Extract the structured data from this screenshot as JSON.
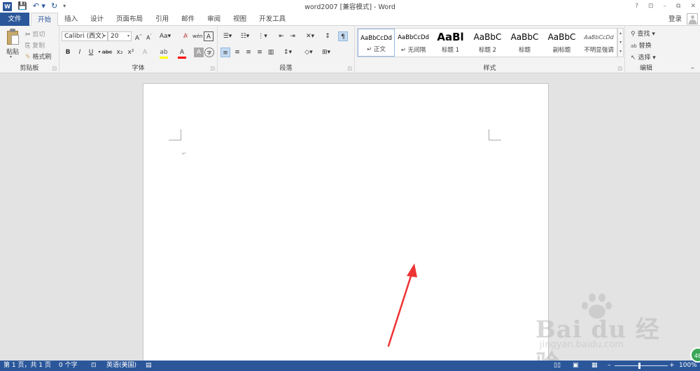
{
  "window": {
    "title": "word2007 [兼容模式] - Word",
    "controls": [
      "?",
      "⊡",
      "–",
      "⧉",
      "✕"
    ]
  },
  "qat": {
    "undo_icon": "undo-icon",
    "redo_icon": "redo-icon",
    "save_icon": "save-icon"
  },
  "tabs": {
    "file": "文件",
    "items": [
      "开始",
      "插入",
      "设计",
      "页面布局",
      "引用",
      "邮件",
      "审阅",
      "视图",
      "开发工具"
    ],
    "login": "登录"
  },
  "ribbon": {
    "clipboard": {
      "label": "剪贴板",
      "paste": "粘贴",
      "cut": "剪切",
      "copy": "复制",
      "format_painter": "格式刷"
    },
    "font": {
      "label": "字体",
      "font_name": "Calibri (西文)",
      "font_size": "20",
      "grow": "A˄",
      "shrink": "A˅",
      "case": "Aa",
      "bold": "B",
      "italic": "I",
      "underline": "U",
      "strike": "abc",
      "sub": "x₂",
      "sup": "x²",
      "phonetic": "wén"
    },
    "paragraph": {
      "label": "段落"
    },
    "styles": {
      "label": "样式",
      "items": [
        {
          "sample": "AaBbCcDd",
          "name": "↵ 正文"
        },
        {
          "sample": "AaBbCcDd",
          "name": "↵ 无间隔"
        },
        {
          "sample": "AaBl",
          "name": "标题 1"
        },
        {
          "sample": "AaBbC",
          "name": "标题 2"
        },
        {
          "sample": "AaBbC",
          "name": "标题"
        },
        {
          "sample": "AaBbC",
          "name": "副标题"
        },
        {
          "sample": "AaBbCcDd",
          "name": "不明显强调"
        }
      ]
    },
    "editing": {
      "label": "编辑",
      "find": "查找",
      "replace": "替换",
      "select": "选择"
    }
  },
  "document": {
    "paragraph_mark": "↵"
  },
  "watermark": {
    "brand": "Bai du 经验",
    "url": "jingyan.baidu.com"
  },
  "statusbar": {
    "page": "第 1 页，共 1 页",
    "words": "0 个字",
    "language": "英语(美国)",
    "zoom": "100%"
  },
  "badge": "48"
}
